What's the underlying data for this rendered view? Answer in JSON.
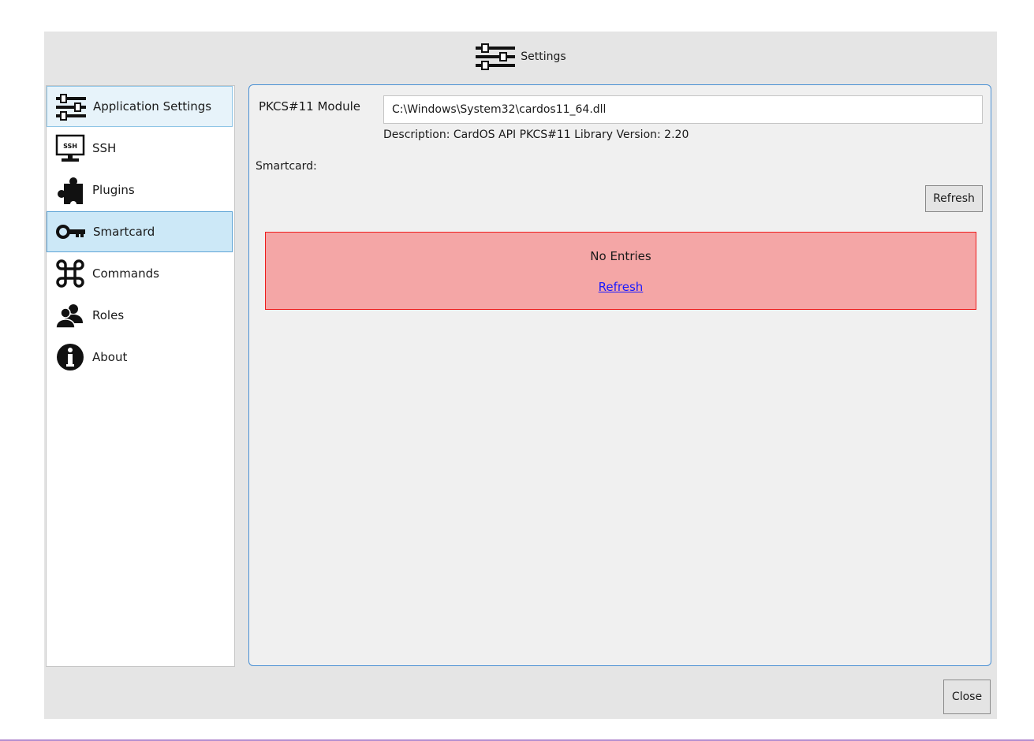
{
  "header": {
    "title": "Settings",
    "icon": "sliders-icon"
  },
  "sidebar": {
    "items": [
      {
        "label": "Application Settings",
        "icon": "sliders-icon"
      },
      {
        "label": "SSH",
        "icon": "ssh-terminal-icon"
      },
      {
        "label": "Plugins",
        "icon": "puzzle-icon"
      },
      {
        "label": "Smartcard",
        "icon": "key-icon"
      },
      {
        "label": "Commands",
        "icon": "command-icon"
      },
      {
        "label": "Roles",
        "icon": "users-icon"
      },
      {
        "label": "About",
        "icon": "info-icon"
      }
    ],
    "selected": "Smartcard"
  },
  "main": {
    "module_label": "PKCS#11 Module",
    "module_value": "C:\\Windows\\System32\\cardos11_64.dll",
    "description": "Description: CardOS API PKCS#11 Library Version: 2.20",
    "smartcard_label": "Smartcard:",
    "refresh_label": "Refresh",
    "empty_text": "No Entries",
    "empty_link": "Refresh"
  },
  "footer": {
    "close_label": "Close"
  },
  "colors": {
    "accent_border": "#4a90d4",
    "selected_bg": "#cce8f7",
    "error_bg": "#f4a6a6",
    "error_border": "#ee1c1c",
    "link": "#1a1aff"
  }
}
